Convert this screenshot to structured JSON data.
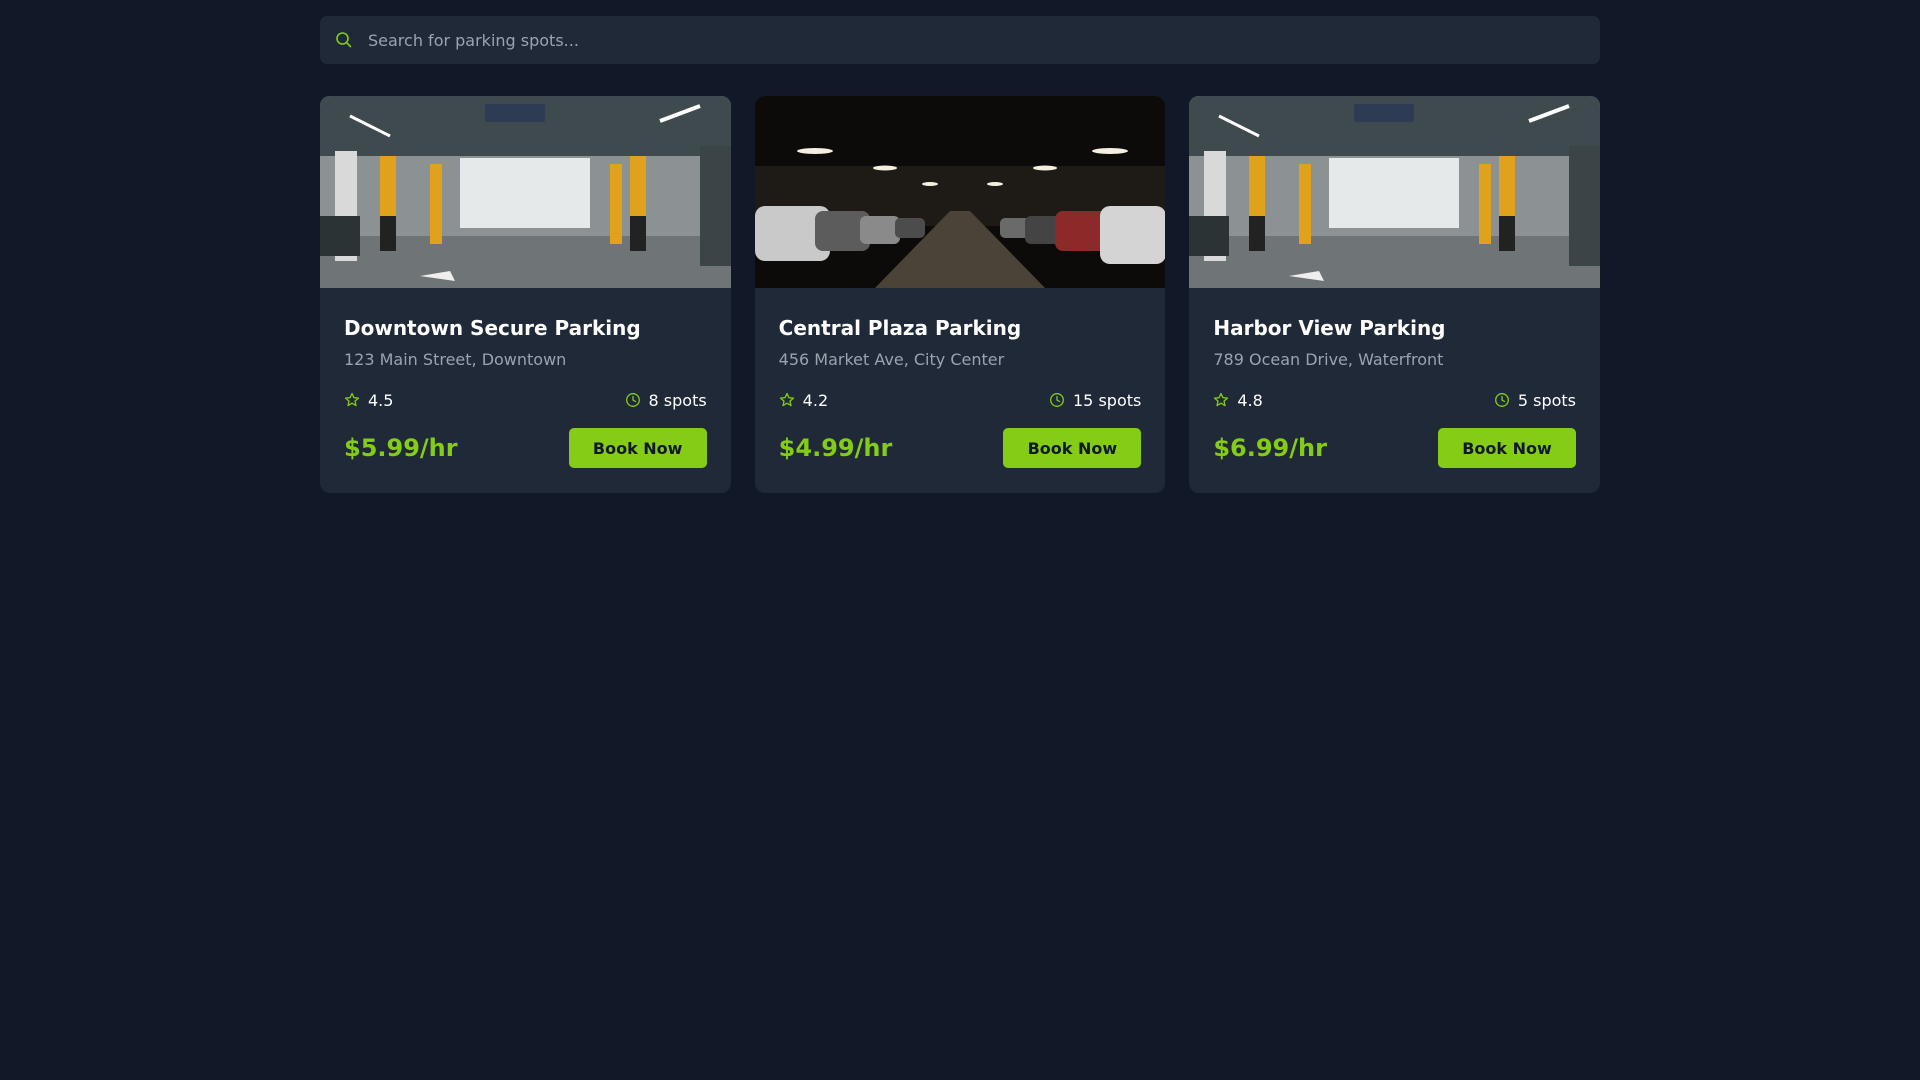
{
  "search": {
    "placeholder": "Search for parking spots..."
  },
  "colors": {
    "background": "#111827",
    "card": "#1f2937",
    "accent": "#84cc16",
    "muted_text": "#9ca3af"
  },
  "icons": {
    "search": "search-icon",
    "rating": "star-icon",
    "availability": "clock-icon"
  },
  "cards": [
    {
      "image": "parking-garage-photo-bright",
      "title": "Downtown Secure Parking",
      "address": "123 Main Street, Downtown",
      "rating": "4.5",
      "spots": "8 spots",
      "price": "$5.99/hr",
      "button": "Book Now"
    },
    {
      "image": "parking-garage-photo-dark",
      "title": "Central Plaza Parking",
      "address": "456 Market Ave, City Center",
      "rating": "4.2",
      "spots": "15 spots",
      "price": "$4.99/hr",
      "button": "Book Now"
    },
    {
      "image": "parking-garage-photo-bright",
      "title": "Harbor View Parking",
      "address": "789 Ocean Drive, Waterfront",
      "rating": "4.8",
      "spots": "5 spots",
      "price": "$6.99/hr",
      "button": "Book Now"
    }
  ]
}
